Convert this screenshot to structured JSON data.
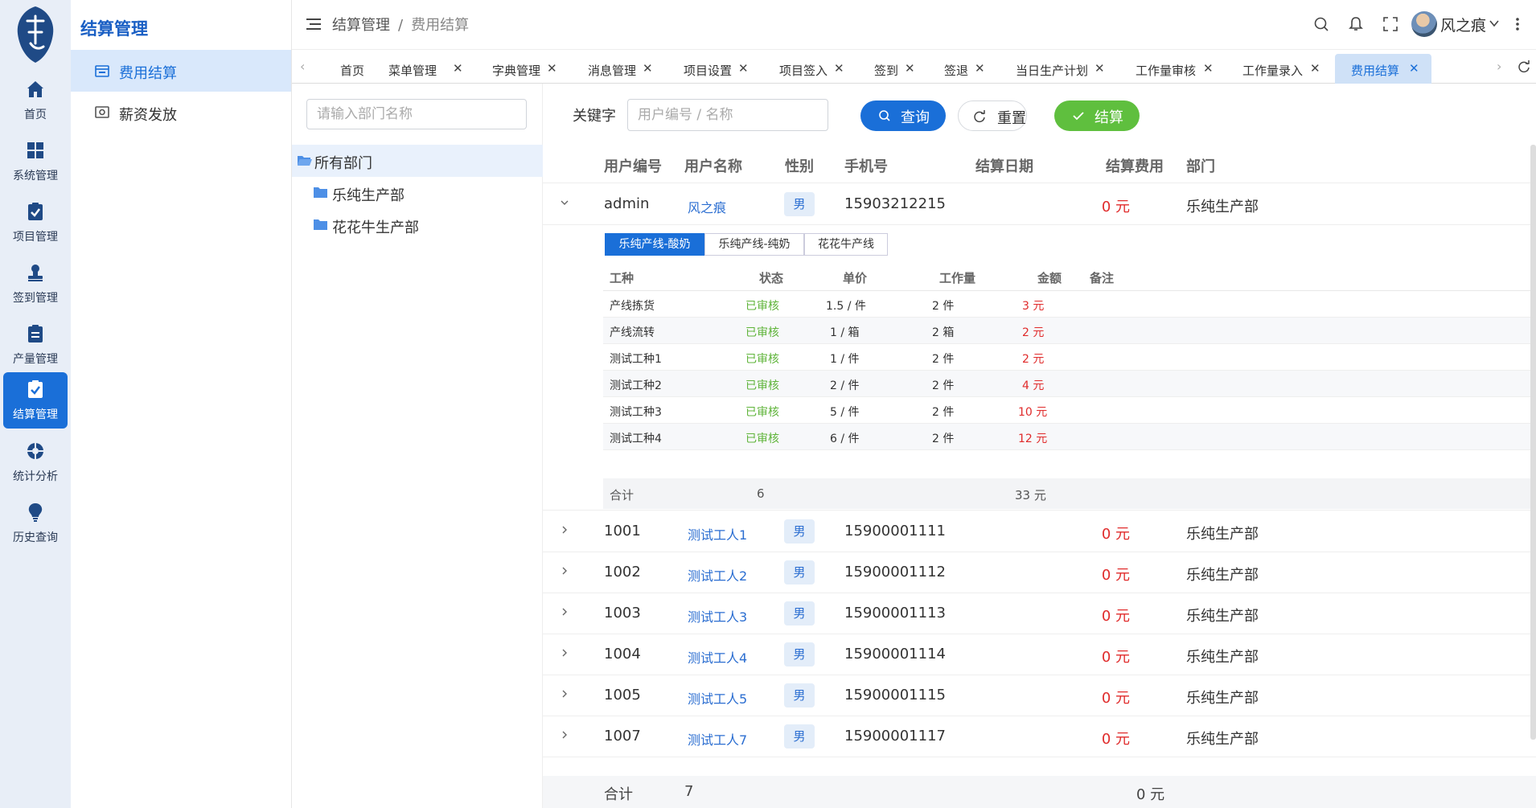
{
  "rail": {
    "items": [
      {
        "label": "首页",
        "icon": "home-icon"
      },
      {
        "label": "系统管理",
        "icon": "grid-icon"
      },
      {
        "label": "项目管理",
        "icon": "clipboard-check-icon"
      },
      {
        "label": "签到管理",
        "icon": "user-stamp-icon"
      },
      {
        "label": "产量管理",
        "icon": "clipboard-list-icon"
      },
      {
        "label": "结算管理",
        "icon": "settle-icon"
      },
      {
        "label": "统计分析",
        "icon": "lifebuoy-icon"
      },
      {
        "label": "历史查询",
        "icon": "bulb-icon"
      }
    ]
  },
  "submenu": {
    "title": "结算管理",
    "items": [
      {
        "label": "费用结算",
        "icon": "calendar-icon"
      },
      {
        "label": "薪资发放",
        "icon": "pay-icon"
      }
    ]
  },
  "header": {
    "breadcrumb": [
      "结算管理",
      "/",
      "费用结算"
    ],
    "username": "风之痕"
  },
  "tabs": [
    {
      "label": "首页"
    },
    {
      "label": "菜单管理"
    },
    {
      "label": "字典管理"
    },
    {
      "label": "消息管理"
    },
    {
      "label": "项目设置"
    },
    {
      "label": "项目签入"
    },
    {
      "label": "签到"
    },
    {
      "label": "签退"
    },
    {
      "label": "当日生产计划"
    },
    {
      "label": "工作量审核"
    },
    {
      "label": "工作量录入"
    },
    {
      "label": "费用结算"
    }
  ],
  "dept": {
    "search_placeholder": "请输入部门名称",
    "tree": [
      "所有部门",
      "乐纯生产部",
      "花花牛生产部"
    ]
  },
  "filter": {
    "keyword_label": "关键字",
    "keyword_placeholder": "用户编号 / 名称",
    "query": "查询",
    "reset": "重置",
    "settle": "结算"
  },
  "table": {
    "columns": [
      "用户编号",
      "用户名称",
      "性别",
      "手机号",
      "结算日期",
      "结算费用",
      "部门"
    ],
    "rows": [
      {
        "id": "admin",
        "name": "风之痕",
        "gender": "男",
        "phone": "15903212215",
        "date": "",
        "fee": "0 元",
        "dept": "乐纯生产部"
      },
      {
        "id": "1001",
        "name": "测试工人1",
        "gender": "男",
        "phone": "15900001111",
        "date": "",
        "fee": "0 元",
        "dept": "乐纯生产部"
      },
      {
        "id": "1002",
        "name": "测试工人2",
        "gender": "男",
        "phone": "15900001112",
        "date": "",
        "fee": "0 元",
        "dept": "乐纯生产部"
      },
      {
        "id": "1003",
        "name": "测试工人3",
        "gender": "男",
        "phone": "15900001113",
        "date": "",
        "fee": "0 元",
        "dept": "乐纯生产部"
      },
      {
        "id": "1004",
        "name": "测试工人4",
        "gender": "男",
        "phone": "15900001114",
        "date": "",
        "fee": "0 元",
        "dept": "乐纯生产部"
      },
      {
        "id": "1005",
        "name": "测试工人5",
        "gender": "男",
        "phone": "15900001115",
        "date": "",
        "fee": "0 元",
        "dept": "乐纯生产部"
      },
      {
        "id": "1007",
        "name": "测试工人7",
        "gender": "男",
        "phone": "15900001117",
        "date": "",
        "fee": "0 元",
        "dept": "乐纯生产部"
      }
    ],
    "footer": {
      "label": "合计",
      "count": "7",
      "total": "0 元"
    }
  },
  "detail": {
    "subtabs": [
      "乐纯产线-酸奶",
      "乐纯产线-纯奶",
      "花花牛产线"
    ],
    "columns": [
      "工种",
      "状态",
      "单价",
      "工作量",
      "金额",
      "备注"
    ],
    "rows": [
      {
        "type": "产线拣货",
        "status": "已审核",
        "price": "1.5 / 件",
        "qty": "2 件",
        "amount": "3 元",
        "note": ""
      },
      {
        "type": "产线流转",
        "status": "已审核",
        "price": "1 / 箱",
        "qty": "2 箱",
        "amount": "2 元",
        "note": ""
      },
      {
        "type": "测试工种1",
        "status": "已审核",
        "price": "1 / 件",
        "qty": "2 件",
        "amount": "2 元",
        "note": ""
      },
      {
        "type": "测试工种2",
        "status": "已审核",
        "price": "2 / 件",
        "qty": "2 件",
        "amount": "4 元",
        "note": ""
      },
      {
        "type": "测试工种3",
        "status": "已审核",
        "price": "5 / 件",
        "qty": "2 件",
        "amount": "10 元",
        "note": ""
      },
      {
        "type": "测试工种4",
        "status": "已审核",
        "price": "6 / 件",
        "qty": "2 件",
        "amount": "12 元",
        "note": ""
      }
    ],
    "footer": {
      "label": "合计",
      "count": "6",
      "total": "33 元"
    }
  },
  "colors": {
    "primary": "#1a6fd8",
    "success": "#5fbf3e",
    "danger": "#e02b2b",
    "rail_bg": "#e8eef7"
  }
}
